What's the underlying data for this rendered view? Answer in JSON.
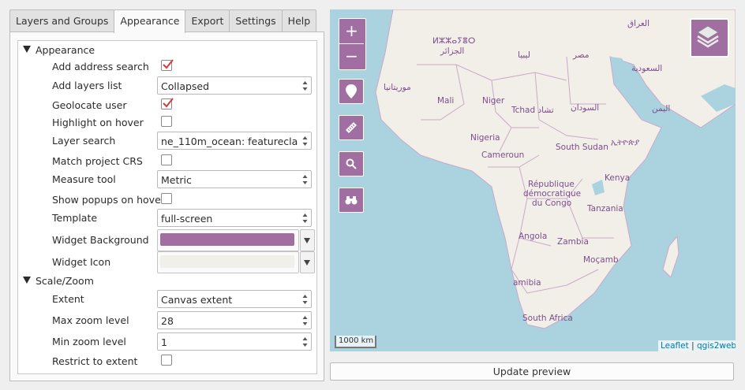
{
  "tabs": [
    {
      "label": "Layers and Groups"
    },
    {
      "label": "Appearance"
    },
    {
      "label": "Export"
    },
    {
      "label": "Settings"
    },
    {
      "label": "Help"
    }
  ],
  "groups": {
    "appearance": "Appearance",
    "scale_zoom": "Scale/Zoom"
  },
  "settings": {
    "add_address_search": {
      "label": "Add address search",
      "checked": true
    },
    "add_layers_list": {
      "label": "Add layers list",
      "value": "Collapsed"
    },
    "geolocate_user": {
      "label": "Geolocate user",
      "checked": true
    },
    "highlight_on_hover": {
      "label": "Highlight on hover",
      "checked": false
    },
    "layer_search": {
      "label": "Layer search",
      "value": "ne_110m_ocean: featurecla"
    },
    "match_project_crs": {
      "label": "Match project CRS",
      "checked": false
    },
    "measure_tool": {
      "label": "Measure tool",
      "value": "Metric"
    },
    "show_popups_on_hover": {
      "label": "Show popups on hover",
      "checked": false
    },
    "template": {
      "label": "Template",
      "value": "full-screen"
    },
    "widget_background": {
      "label": "Widget Background",
      "color": "#a06ea0"
    },
    "widget_icon": {
      "label": "Widget Icon",
      "color": "#f0efe9"
    },
    "extent": {
      "label": "Extent",
      "value": "Canvas extent"
    },
    "max_zoom_level": {
      "label": "Max zoom level",
      "value": "28"
    },
    "min_zoom_level": {
      "label": "Min zoom level",
      "value": "1"
    },
    "restrict_to_extent": {
      "label": "Restrict to extent",
      "checked": false
    }
  },
  "map": {
    "zoom_in": "+",
    "zoom_out": "−",
    "scale": "1000 km",
    "attribution_leaflet": "Leaflet",
    "attribution_sep": " | ",
    "attribution_qgis2web": "qgis2web,",
    "ocean_color": "#aad3df",
    "land_color": "#f2efe9",
    "labels": [
      {
        "text": "ⵍⵣⵣⴰⵢⴻⵔ"
      },
      {
        "text": "الجزائر"
      },
      {
        "text": "ليبيا"
      },
      {
        "text": "مصر"
      },
      {
        "text": "العراق"
      },
      {
        "text": "السعودية"
      },
      {
        "text": "موريتانيا"
      },
      {
        "text": "Mali"
      },
      {
        "text": "Niger"
      },
      {
        "text": "Tchad تشاد"
      },
      {
        "text": "السودان"
      },
      {
        "text": "اليمن"
      },
      {
        "text": "Nigeria"
      },
      {
        "text": "South Sudan"
      },
      {
        "text": "ኢትዮጵያ"
      },
      {
        "text": "Cameroun"
      },
      {
        "text": "République"
      },
      {
        "text": "démocratique"
      },
      {
        "text": "du Congo"
      },
      {
        "text": "Kenya"
      },
      {
        "text": "Tanzania"
      },
      {
        "text": "Angola"
      },
      {
        "text": "Zambia"
      },
      {
        "text": "Moçamb"
      },
      {
        "text": "amibia"
      },
      {
        "text": "South Africa"
      }
    ]
  },
  "update_preview": "Update preview"
}
